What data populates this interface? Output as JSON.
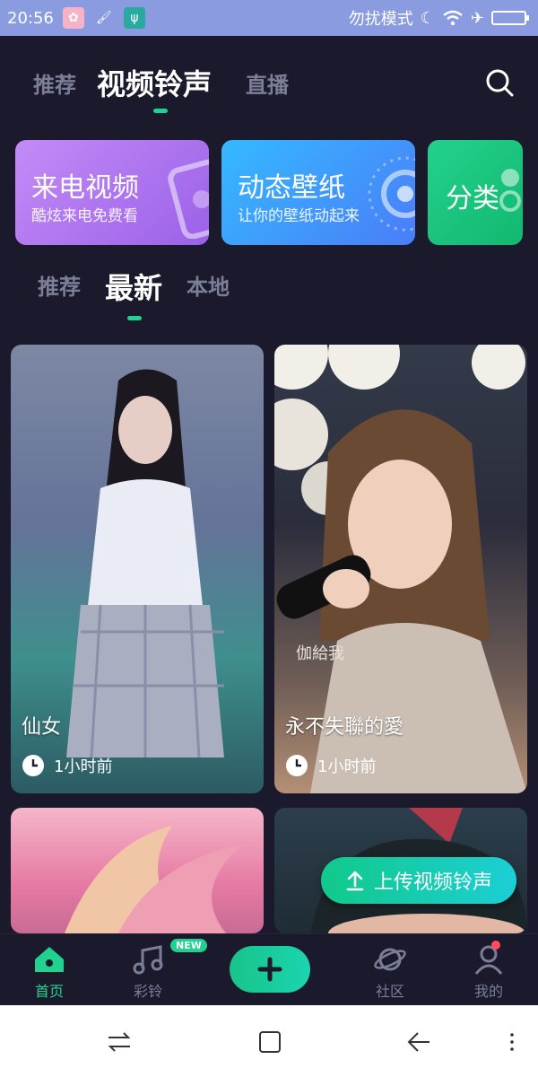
{
  "status_bar": {
    "time": "20:56",
    "dnd_text": "勿扰模式"
  },
  "top_tabs": [
    "推荐",
    "视频铃声",
    "直播"
  ],
  "banners": [
    {
      "title": "来电视频",
      "subtitle": "酷炫来电免费看"
    },
    {
      "title": "动态壁纸",
      "subtitle": "让你的壁纸动起来"
    },
    {
      "title": "分类"
    }
  ],
  "sub_tabs": [
    "推荐",
    "最新",
    "本地"
  ],
  "videos": [
    {
      "title": "仙女",
      "time": "1小时前"
    },
    {
      "title": "永不失聯的愛",
      "time": "1小时前",
      "overlay_text": "伽給我"
    },
    {},
    {}
  ],
  "upload_button": {
    "label": "上传视频铃声"
  },
  "bottom_nav": {
    "home": "首页",
    "ringtone": "彩铃",
    "new_badge": "NEW",
    "community": "社区",
    "mine": "我的"
  },
  "colors": {
    "accent": "#1fd28f",
    "background": "#1b1a2c"
  }
}
